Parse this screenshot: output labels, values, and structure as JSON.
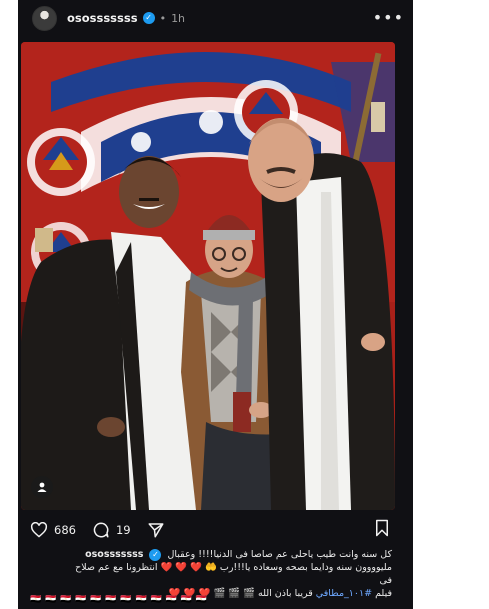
{
  "post": {
    "username": "ososssssss",
    "verified": true,
    "dot": "•",
    "time": "1h",
    "more_icon": "more-horizontal-icon",
    "more_label": "•••"
  },
  "actions": {
    "likes": "686",
    "comments": "19",
    "like_icon": "heart-icon",
    "comment_icon": "comment-bubble-icon",
    "share_icon": "send-icon",
    "save_icon": "bookmark-icon"
  },
  "caption": {
    "username": "ososssssss",
    "line1": "كل سنه وانت طيب ياحلى عم صاصا فى الدنيا!!!! وعقبال",
    "line2": "مليوووون سنه ودايما بصحه وسعاده يا!!!رب 🤲 ❤️ ❤️ ❤️ انتظرونا مع عم صلاح",
    "line3": "فى",
    "line4_text": "فيلم",
    "line4_hashtag": "#١٠١_مطافي",
    "line4_rest": "قريبا باذن الله 🎬 🎬 🎬 ❤️ ❤️ ❤️",
    "flags": "🇪🇬 🇪🇬 🇪🇬 🇪🇬 🇪🇬 🇪🇬 🇪🇬 🇪🇬 🇪🇬 🇪🇬 🇪🇬 🇪🇬"
  },
  "colors": {
    "background": "#101014",
    "verified": "#1d9bf0",
    "hashtag": "#6ea8ff",
    "tent_red": "#b3241c",
    "tent_blue": "#1f3f8f"
  }
}
